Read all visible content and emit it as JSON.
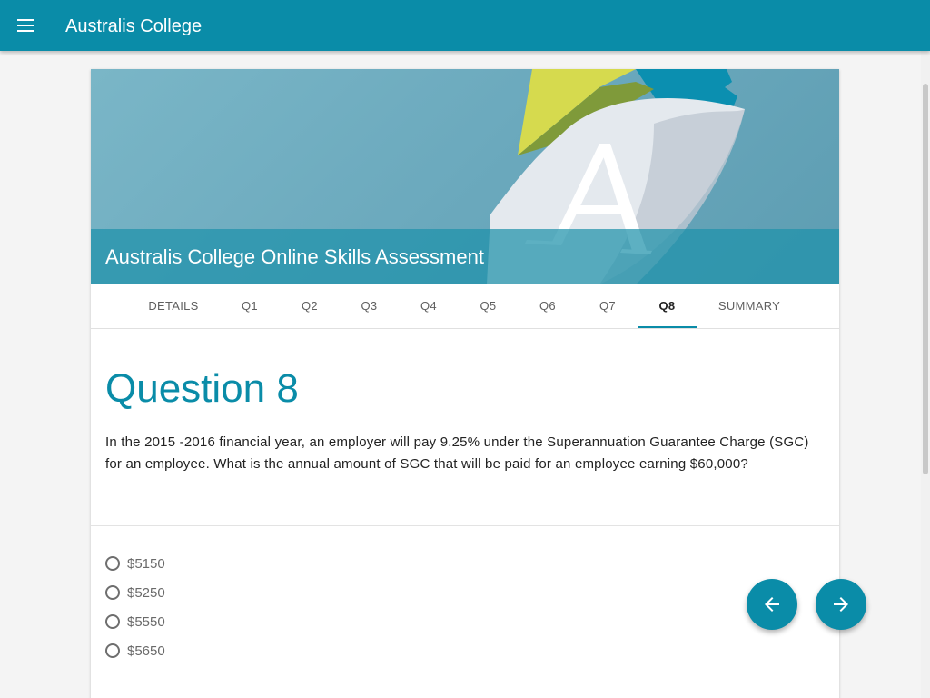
{
  "app": {
    "title": "Australis College"
  },
  "hero": {
    "title": "Australis College Online Skills Assessment"
  },
  "tabs": [
    {
      "label": "DETAILS"
    },
    {
      "label": "Q1"
    },
    {
      "label": "Q2"
    },
    {
      "label": "Q3"
    },
    {
      "label": "Q4"
    },
    {
      "label": "Q5"
    },
    {
      "label": "Q6"
    },
    {
      "label": "Q7"
    },
    {
      "label": "Q8",
      "active": true
    },
    {
      "label": "SUMMARY"
    }
  ],
  "question": {
    "heading": "Question 8",
    "text": "In the 2015 -2016 financial year, an employer will pay 9.25% under the Superannuation Guarantee Charge (SGC) for an employee. What is the annual amount of SGC that will be paid for an employee earning $60,000?",
    "options": [
      "$5150",
      "$5250",
      "$5550",
      "$5650"
    ]
  },
  "nav": {
    "prev_icon": "arrow-left-icon",
    "next_icon": "arrow-right-icon"
  },
  "colors": {
    "primary": "#0a8ca8",
    "background": "#f4f4f4"
  }
}
